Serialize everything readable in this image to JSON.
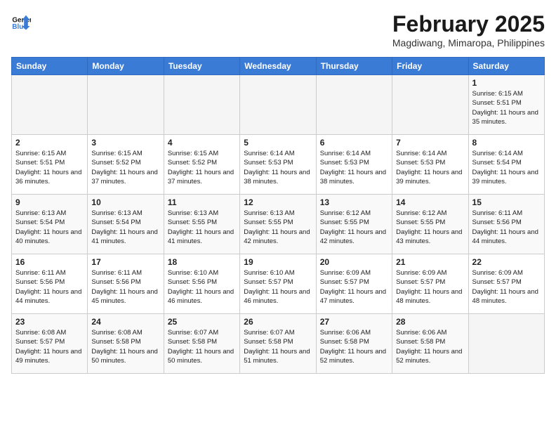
{
  "header": {
    "logo_line1": "General",
    "logo_line2": "Blue",
    "month_year": "February 2025",
    "location": "Magdiwang, Mimaropa, Philippines"
  },
  "weekdays": [
    "Sunday",
    "Monday",
    "Tuesday",
    "Wednesday",
    "Thursday",
    "Friday",
    "Saturday"
  ],
  "weeks": [
    [
      {
        "day": "",
        "sunrise": "",
        "sunset": "",
        "daylight": "",
        "empty": true
      },
      {
        "day": "",
        "sunrise": "",
        "sunset": "",
        "daylight": "",
        "empty": true
      },
      {
        "day": "",
        "sunrise": "",
        "sunset": "",
        "daylight": "",
        "empty": true
      },
      {
        "day": "",
        "sunrise": "",
        "sunset": "",
        "daylight": "",
        "empty": true
      },
      {
        "day": "",
        "sunrise": "",
        "sunset": "",
        "daylight": "",
        "empty": true
      },
      {
        "day": "",
        "sunrise": "",
        "sunset": "",
        "daylight": "",
        "empty": true
      },
      {
        "day": "1",
        "sunrise": "Sunrise: 6:15 AM",
        "sunset": "Sunset: 5:51 PM",
        "daylight": "Daylight: 11 hours and 35 minutes.",
        "empty": false
      }
    ],
    [
      {
        "day": "2",
        "sunrise": "Sunrise: 6:15 AM",
        "sunset": "Sunset: 5:51 PM",
        "daylight": "Daylight: 11 hours and 36 minutes.",
        "empty": false
      },
      {
        "day": "3",
        "sunrise": "Sunrise: 6:15 AM",
        "sunset": "Sunset: 5:52 PM",
        "daylight": "Daylight: 11 hours and 37 minutes.",
        "empty": false
      },
      {
        "day": "4",
        "sunrise": "Sunrise: 6:15 AM",
        "sunset": "Sunset: 5:52 PM",
        "daylight": "Daylight: 11 hours and 37 minutes.",
        "empty": false
      },
      {
        "day": "5",
        "sunrise": "Sunrise: 6:14 AM",
        "sunset": "Sunset: 5:53 PM",
        "daylight": "Daylight: 11 hours and 38 minutes.",
        "empty": false
      },
      {
        "day": "6",
        "sunrise": "Sunrise: 6:14 AM",
        "sunset": "Sunset: 5:53 PM",
        "daylight": "Daylight: 11 hours and 38 minutes.",
        "empty": false
      },
      {
        "day": "7",
        "sunrise": "Sunrise: 6:14 AM",
        "sunset": "Sunset: 5:53 PM",
        "daylight": "Daylight: 11 hours and 39 minutes.",
        "empty": false
      },
      {
        "day": "8",
        "sunrise": "Sunrise: 6:14 AM",
        "sunset": "Sunset: 5:54 PM",
        "daylight": "Daylight: 11 hours and 39 minutes.",
        "empty": false
      }
    ],
    [
      {
        "day": "9",
        "sunrise": "Sunrise: 6:13 AM",
        "sunset": "Sunset: 5:54 PM",
        "daylight": "Daylight: 11 hours and 40 minutes.",
        "empty": false
      },
      {
        "day": "10",
        "sunrise": "Sunrise: 6:13 AM",
        "sunset": "Sunset: 5:54 PM",
        "daylight": "Daylight: 11 hours and 41 minutes.",
        "empty": false
      },
      {
        "day": "11",
        "sunrise": "Sunrise: 6:13 AM",
        "sunset": "Sunset: 5:55 PM",
        "daylight": "Daylight: 11 hours and 41 minutes.",
        "empty": false
      },
      {
        "day": "12",
        "sunrise": "Sunrise: 6:13 AM",
        "sunset": "Sunset: 5:55 PM",
        "daylight": "Daylight: 11 hours and 42 minutes.",
        "empty": false
      },
      {
        "day": "13",
        "sunrise": "Sunrise: 6:12 AM",
        "sunset": "Sunset: 5:55 PM",
        "daylight": "Daylight: 11 hours and 42 minutes.",
        "empty": false
      },
      {
        "day": "14",
        "sunrise": "Sunrise: 6:12 AM",
        "sunset": "Sunset: 5:55 PM",
        "daylight": "Daylight: 11 hours and 43 minutes.",
        "empty": false
      },
      {
        "day": "15",
        "sunrise": "Sunrise: 6:11 AM",
        "sunset": "Sunset: 5:56 PM",
        "daylight": "Daylight: 11 hours and 44 minutes.",
        "empty": false
      }
    ],
    [
      {
        "day": "16",
        "sunrise": "Sunrise: 6:11 AM",
        "sunset": "Sunset: 5:56 PM",
        "daylight": "Daylight: 11 hours and 44 minutes.",
        "empty": false
      },
      {
        "day": "17",
        "sunrise": "Sunrise: 6:11 AM",
        "sunset": "Sunset: 5:56 PM",
        "daylight": "Daylight: 11 hours and 45 minutes.",
        "empty": false
      },
      {
        "day": "18",
        "sunrise": "Sunrise: 6:10 AM",
        "sunset": "Sunset: 5:56 PM",
        "daylight": "Daylight: 11 hours and 46 minutes.",
        "empty": false
      },
      {
        "day": "19",
        "sunrise": "Sunrise: 6:10 AM",
        "sunset": "Sunset: 5:57 PM",
        "daylight": "Daylight: 11 hours and 46 minutes.",
        "empty": false
      },
      {
        "day": "20",
        "sunrise": "Sunrise: 6:09 AM",
        "sunset": "Sunset: 5:57 PM",
        "daylight": "Daylight: 11 hours and 47 minutes.",
        "empty": false
      },
      {
        "day": "21",
        "sunrise": "Sunrise: 6:09 AM",
        "sunset": "Sunset: 5:57 PM",
        "daylight": "Daylight: 11 hours and 48 minutes.",
        "empty": false
      },
      {
        "day": "22",
        "sunrise": "Sunrise: 6:09 AM",
        "sunset": "Sunset: 5:57 PM",
        "daylight": "Daylight: 11 hours and 48 minutes.",
        "empty": false
      }
    ],
    [
      {
        "day": "23",
        "sunrise": "Sunrise: 6:08 AM",
        "sunset": "Sunset: 5:57 PM",
        "daylight": "Daylight: 11 hours and 49 minutes.",
        "empty": false
      },
      {
        "day": "24",
        "sunrise": "Sunrise: 6:08 AM",
        "sunset": "Sunset: 5:58 PM",
        "daylight": "Daylight: 11 hours and 50 minutes.",
        "empty": false
      },
      {
        "day": "25",
        "sunrise": "Sunrise: 6:07 AM",
        "sunset": "Sunset: 5:58 PM",
        "daylight": "Daylight: 11 hours and 50 minutes.",
        "empty": false
      },
      {
        "day": "26",
        "sunrise": "Sunrise: 6:07 AM",
        "sunset": "Sunset: 5:58 PM",
        "daylight": "Daylight: 11 hours and 51 minutes.",
        "empty": false
      },
      {
        "day": "27",
        "sunrise": "Sunrise: 6:06 AM",
        "sunset": "Sunset: 5:58 PM",
        "daylight": "Daylight: 11 hours and 52 minutes.",
        "empty": false
      },
      {
        "day": "28",
        "sunrise": "Sunrise: 6:06 AM",
        "sunset": "Sunset: 5:58 PM",
        "daylight": "Daylight: 11 hours and 52 minutes.",
        "empty": false
      },
      {
        "day": "",
        "sunrise": "",
        "sunset": "",
        "daylight": "",
        "empty": true
      }
    ]
  ]
}
